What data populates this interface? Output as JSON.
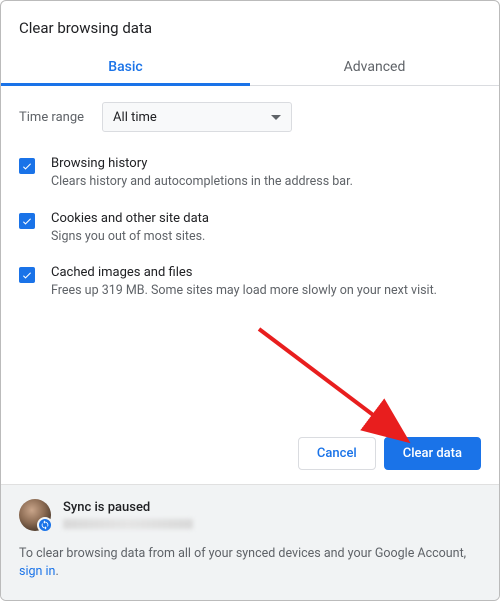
{
  "title": "Clear browsing data",
  "tabs": {
    "basic": "Basic",
    "advanced": "Advanced"
  },
  "time": {
    "label": "Time range",
    "value": "All time"
  },
  "options": [
    {
      "title": "Browsing history",
      "desc": "Clears history and autocompletions in the address bar."
    },
    {
      "title": "Cookies and other site data",
      "desc": "Signs you out of most sites."
    },
    {
      "title": "Cached images and files",
      "desc": "Frees up 319 MB. Some sites may load more slowly on your next visit."
    }
  ],
  "actions": {
    "cancel": "Cancel",
    "confirm": "Clear data"
  },
  "sync": {
    "status": "Sync is paused"
  },
  "footer": {
    "note_prefix": "To clear browsing data from all of your synced devices and your Google Account, ",
    "link": "sign in",
    "note_suffix": "."
  },
  "colors": {
    "accent": "#1a73e8"
  }
}
